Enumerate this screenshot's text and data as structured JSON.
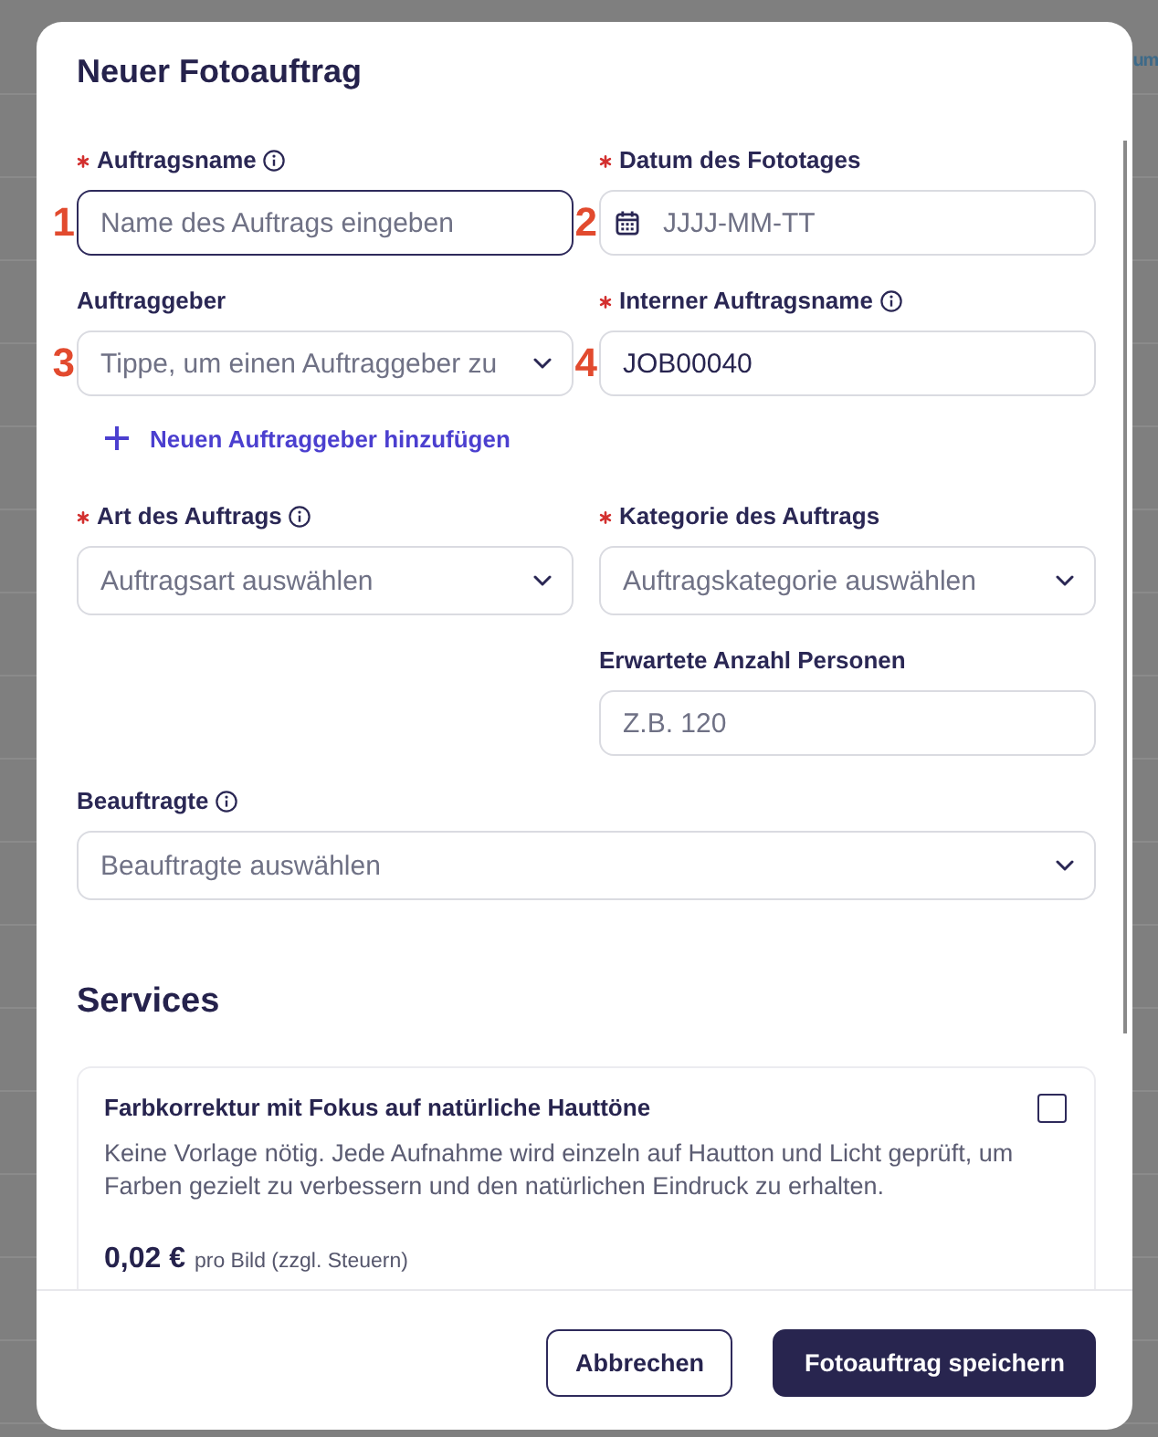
{
  "background": {
    "header_fragment": "um"
  },
  "title": "Neuer Fotoauftrag",
  "form": {
    "rows": [
      {
        "left": {
          "kind": "text",
          "label": "Auftragsname",
          "required": true,
          "info": true,
          "placeholder": "Name des Auftrags eingeben",
          "focused": true,
          "marker": "1"
        },
        "right": {
          "kind": "date",
          "label": "Datum des Fototages",
          "required": true,
          "info": false,
          "placeholder": "JJJJ-MM-TT",
          "focused": false,
          "marker": "2"
        }
      },
      {
        "left": {
          "kind": "combobox",
          "label": "Auftraggeber",
          "required": false,
          "info": false,
          "placeholder": "Tippe, um einen Auftraggeber zu",
          "focused": false,
          "marker": "3",
          "add_link": "Neuen Auftraggeber hinzufügen"
        },
        "right": {
          "kind": "text",
          "label": "Interner Auftragsname",
          "required": true,
          "info": true,
          "value": "JOB00040",
          "focused": false,
          "marker": "4"
        }
      },
      {
        "left": {
          "kind": "select",
          "label": "Art des Auftrags",
          "required": true,
          "info": true,
          "placeholder": "Auftragsart auswählen",
          "focused": false
        },
        "right": {
          "kind": "select",
          "label": "Kategorie des Auftrags",
          "required": true,
          "info": false,
          "placeholder": "Auftragskategorie auswählen",
          "focused": false
        }
      },
      {
        "right": {
          "kind": "text",
          "label": "Erwartete Anzahl Personen",
          "required": false,
          "info": false,
          "placeholder": "Z.B. 120",
          "focused": false
        }
      },
      {
        "full": {
          "kind": "select",
          "label": "Beauftragte",
          "required": false,
          "info": true,
          "placeholder": "Beauftragte auswählen",
          "focused": false
        }
      }
    ]
  },
  "services": {
    "title": "Services",
    "items": [
      {
        "name": "Farbkorrektur mit Fokus auf natürliche Hauttöne",
        "checked": false,
        "description": "Keine Vorlage nötig. Jede Aufnahme wird einzeln auf Hautton und Licht geprüft, um Farben gezielt zu verbessern und den natürlichen Eindruck zu erhalten.",
        "price": "0,02 €",
        "price_unit": "pro Bild (zzgl. Steuern)"
      }
    ]
  },
  "buttons": [
    {
      "label": "Abbrechen",
      "kind": "secondary"
    },
    {
      "label": "Fotoauftrag speichern",
      "kind": "primary"
    }
  ]
}
